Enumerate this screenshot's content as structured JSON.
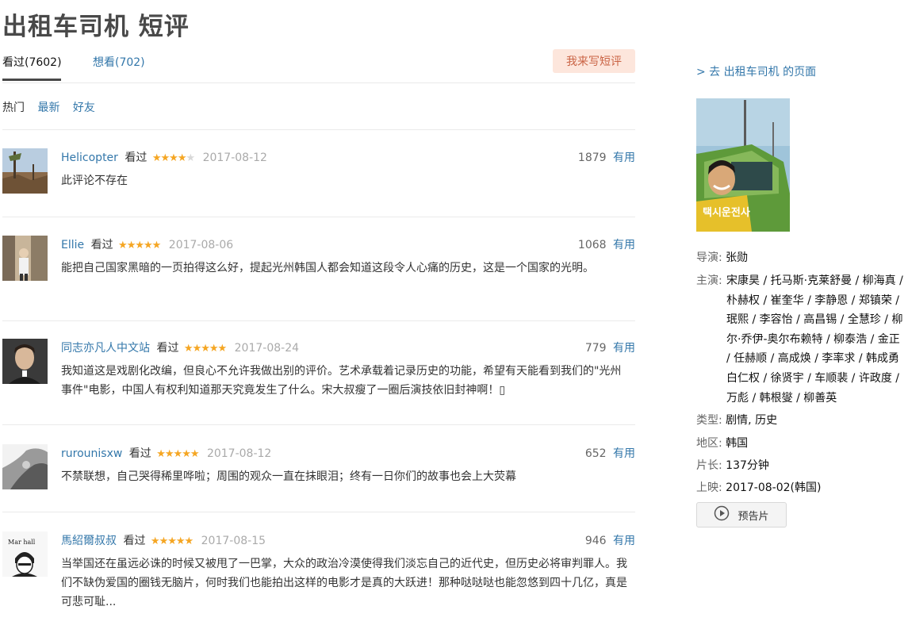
{
  "page_title": "出租车司机 短评",
  "tabs": {
    "watched": "看过(7602)",
    "want": "想看(702)",
    "write_button": "我来写短评"
  },
  "sort": {
    "hot": "热门",
    "latest": "最新",
    "friends": "好友"
  },
  "comments": [
    {
      "user": "Helicopter",
      "status": "看过",
      "stars": 4,
      "date": "2017-08-12",
      "votes": "1879",
      "useful": "有用",
      "text": "此评论不存在"
    },
    {
      "user": "Ellie",
      "status": "看过",
      "stars": 5,
      "date": "2017-08-06",
      "votes": "1068",
      "useful": "有用",
      "text": "能把自己国家黑暗的一页拍得这么好，提起光州韩国人都会知道这段令人心痛的历史，这是一个国家的光明。"
    },
    {
      "user": "同志亦凡人中文站",
      "status": "看过",
      "stars": 5,
      "date": "2017-08-24",
      "votes": "779",
      "useful": "有用",
      "text": "我知道这是戏剧化改编，但良心不允许我做出别的评价。艺术承载着记录历史的功能，希望有天能看到我们的\"光州事件\"电影，中国人有权利知道那天究竟发生了什么。宋大叔瘦了一圈后演技依旧封神啊！▯"
    },
    {
      "user": "rurounisxw",
      "status": "看过",
      "stars": 5,
      "date": "2017-08-12",
      "votes": "652",
      "useful": "有用",
      "text": "不禁联想，自己哭得稀里哗啦；周围的观众一直在抹眼泪；终有一日你们的故事也会上大荧幕"
    },
    {
      "user": "馬紹爾叔叔",
      "status": "看过",
      "stars": 5,
      "date": "2017-08-15",
      "votes": "946",
      "useful": "有用",
      "text": "当举国还在虽远必诛的时候又被甩了一巴掌，大众的政治冷漠使得我们淡忘自己的近代史，但历史必将审判罪人。我们不缺伪爱国的圈钱无脑片，何时我们也能拍出这样的电影才是真的大跃进！那种哒哒哒也能忽悠到四十几亿，真是可悲可耻..."
    }
  ],
  "sidebar": {
    "movie_link": "> 去 出租车司机 的页面",
    "poster_text": "택시운전사",
    "director_label": "导演:",
    "director": "张勋",
    "cast_label": "主演:",
    "cast_lines": [
      "宋康昊 / 托马斯·克莱舒曼 / 柳海真 /",
      "朴赫权 / 崔奎华 / 李静恩 / 郑镇荣 /",
      "珉熙 / 李容怡 / 高昌锡 / 全慧珍 / 柳",
      "尔·乔伊-奥尔布赖特 / 柳泰浩 / 金正",
      "/ 任赫顺 / 高成焕 / 李率求 / 韩成勇",
      "白仁权 / 徐贤宇 / 车顺裴 / 许政度 /",
      "万彪 / 韩根燮 / 柳善英"
    ],
    "genre_label": "类型:",
    "genre": "剧情, 历史",
    "region_label": "地区:",
    "region": "韩国",
    "runtime_label": "片长:",
    "runtime": "137分钟",
    "release_label": "上映:",
    "release": "2017-08-02(韩国)",
    "trailer_button": "预告片",
    "trailer_icon": "play-circle-icon"
  },
  "colors": {
    "link": "#3377aa",
    "star": "#f5a623",
    "write_button_bg": "#fde6dc",
    "write_button_text": "#ca6445"
  }
}
